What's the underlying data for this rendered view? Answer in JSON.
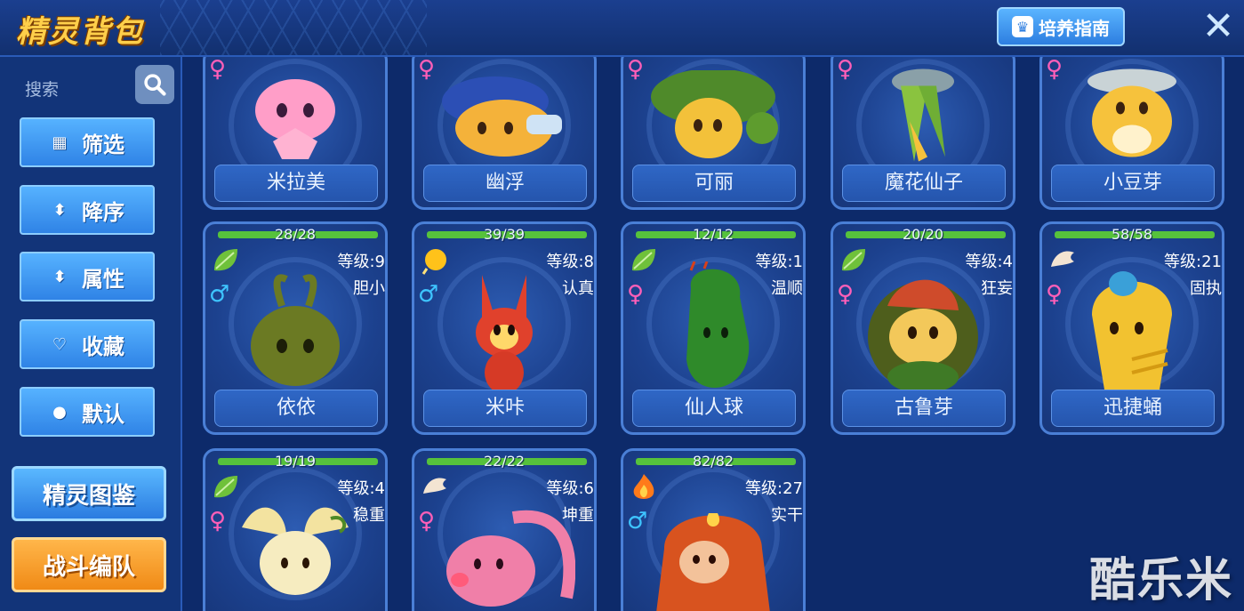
{
  "header": {
    "title": "精灵背包",
    "guide_label": "培养指南"
  },
  "sidebar": {
    "search_label": "搜索",
    "filters": [
      {
        "label": "筛选",
        "icon": "grid-icon"
      },
      {
        "label": "降序",
        "icon": "sort-icon"
      },
      {
        "label": "属性",
        "icon": "sort-icon"
      },
      {
        "label": "收藏",
        "icon": "heart-icon"
      },
      {
        "label": "默认",
        "icon": "flame-head-icon"
      }
    ],
    "codex_label": "精灵图鉴",
    "team_label": "战斗编队"
  },
  "row1": [
    {
      "name": "米拉美",
      "gender": "♀",
      "color": "#ff9ec8"
    },
    {
      "name": "幽浮",
      "gender": "♀",
      "color": "#f4b23a"
    },
    {
      "name": "可丽",
      "gender": "♀",
      "color": "#6fae35"
    },
    {
      "name": "魔花仙子",
      "gender": "♀",
      "color": "#7fbd3f"
    },
    {
      "name": "小豆芽",
      "gender": "♀",
      "color": "#f6c23c"
    }
  ],
  "row2": [
    {
      "name": "依依",
      "hp": "28/28",
      "level": "等级:9",
      "nature": "胆小",
      "gender": "♂",
      "element": "grass",
      "color": "#6b7a23"
    },
    {
      "name": "米咔",
      "hp": "39/39",
      "level": "等级:8",
      "nature": "认真",
      "gender": "♂",
      "element": "light",
      "color": "#e0412c"
    },
    {
      "name": "仙人球",
      "hp": "12/12",
      "level": "等级:1",
      "nature": "温顺",
      "gender": "♀",
      "element": "grass",
      "color": "#2f8a2a"
    },
    {
      "name": "古鲁芽",
      "hp": "20/20",
      "level": "等级:4",
      "nature": "狂妄",
      "gender": "♀",
      "element": "grass",
      "color": "#cf4b2b"
    },
    {
      "name": "迅捷蛹",
      "hp": "58/58",
      "level": "等级:21",
      "nature": "固执",
      "gender": "♀",
      "element": "wing",
      "color": "#f2c230"
    }
  ],
  "row3": [
    {
      "hp": "19/19",
      "level": "等级:4",
      "nature": "稳重",
      "gender": "♀",
      "element": "grass",
      "color": "#f3e3a0"
    },
    {
      "hp": "22/22",
      "level": "等级:6",
      "nature": "坤重",
      "gender": "♀",
      "element": "wing",
      "color": "#f07fa8"
    },
    {
      "hp": "82/82",
      "level": "等级:27",
      "nature": "实干",
      "gender": "♂",
      "element": "fire",
      "color": "#d8531f"
    }
  ],
  "watermark": "酷乐米"
}
